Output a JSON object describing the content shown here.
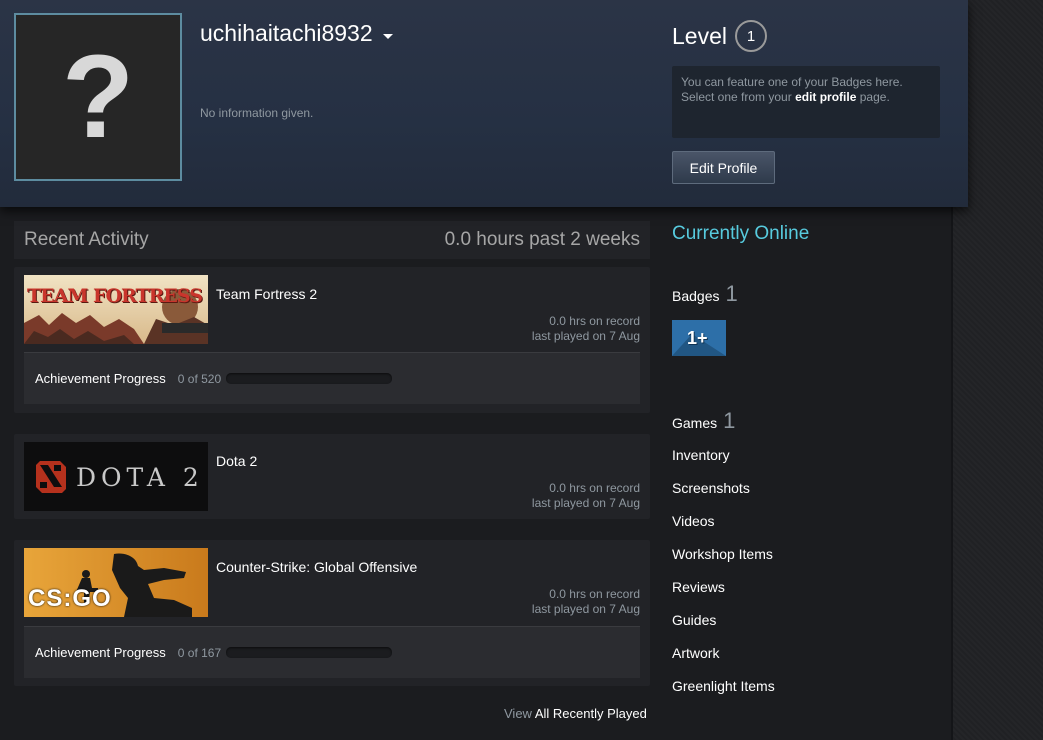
{
  "profile": {
    "persona_name": "uchihaitachi8932",
    "summary": "No information given.",
    "avatar_glyph": "?",
    "level_label": "Level",
    "level": "1",
    "badge_text_1": "You can feature one of your Badges here.",
    "badge_text_2": "Select one from your",
    "badge_link": "edit profile",
    "badge_text_3": "page.",
    "edit_button": "Edit Profile"
  },
  "recent_activity": {
    "title": "Recent Activity",
    "hours": "0.0 hours past 2 weeks",
    "games": [
      {
        "name": "Team Fortress 2",
        "capsule_text": "TEAM FORTRESS 2",
        "hours": "0.0 hrs on record",
        "last_played": "last played on 7 Aug",
        "achievement_label": "Achievement Progress",
        "achievement_count": "0 of 520",
        "achievement_fraction": 0
      },
      {
        "name": "Dota 2",
        "capsule_text": "DOTA 2",
        "hours": "0.0 hrs on record",
        "last_played": "last played on 7 Aug"
      },
      {
        "name": "Counter-Strike: Global Offensive",
        "capsule_text": "CS:GO",
        "hours": "0.0 hrs on record",
        "last_played": "last played on 7 Aug",
        "achievement_label": "Achievement Progress",
        "achievement_count": "0 of 167",
        "achievement_fraction": 0
      }
    ],
    "view_prefix": "View",
    "view_link": "All Recently Played"
  },
  "sidebar": {
    "status": "Currently Online",
    "badges_label": "Badges",
    "badges_count": "1",
    "badge_icon_text": "1+",
    "games_label": "Games",
    "games_count": "1",
    "links": [
      "Inventory",
      "Screenshots",
      "Videos",
      "Workshop Items",
      "Reviews",
      "Guides",
      "Artwork",
      "Greenlight Items"
    ]
  },
  "colors": {
    "accent_online": "#57cbde",
    "background": "#1b1c1f",
    "header": "#2b3446"
  }
}
